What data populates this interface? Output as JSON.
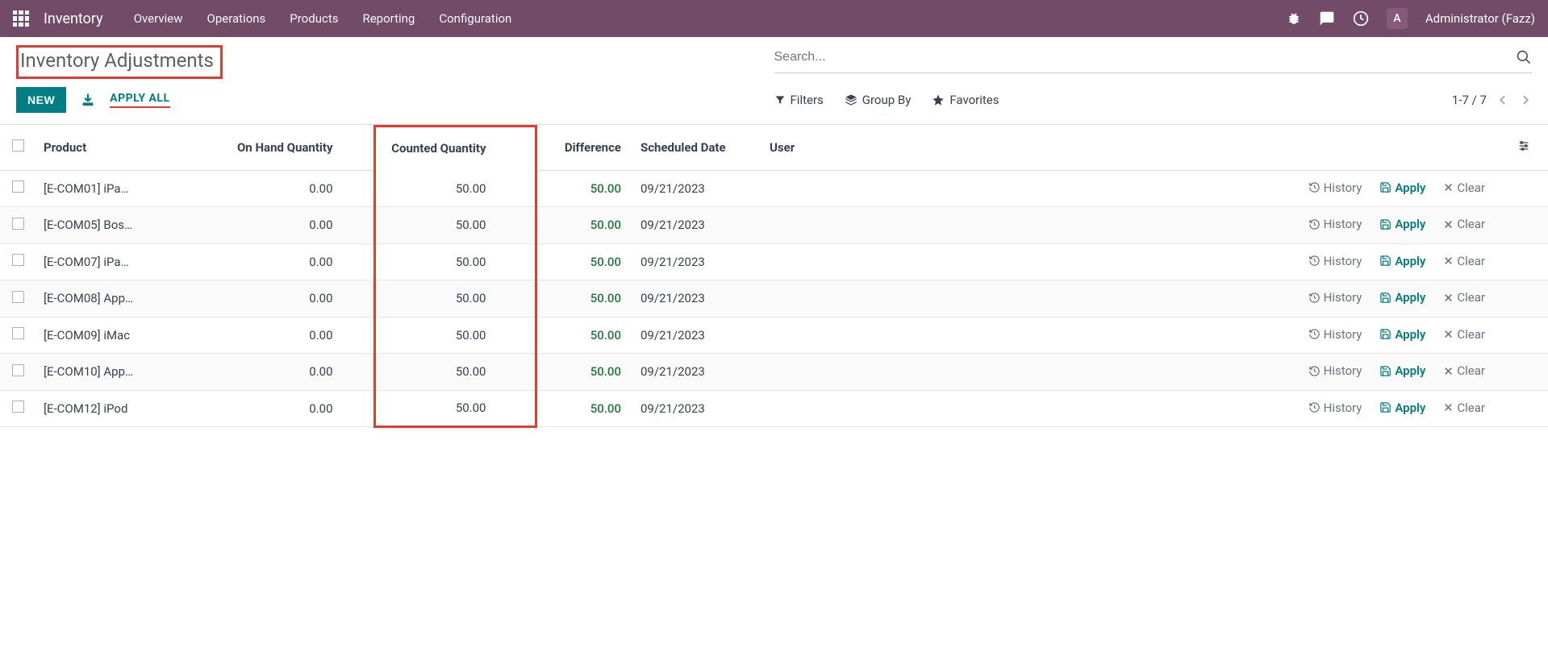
{
  "navbar": {
    "app_title": "Inventory",
    "links": [
      "Overview",
      "Operations",
      "Products",
      "Reporting",
      "Configuration"
    ],
    "avatar_letter": "A",
    "user_name": "Administrator (Fazz)"
  },
  "control_panel": {
    "breadcrumb": "Inventory Adjustments",
    "new_label": "NEW",
    "apply_all_label": "APPLY ALL",
    "search_placeholder": "Search...",
    "filters_label": "Filters",
    "groupby_label": "Group By",
    "favorites_label": "Favorites",
    "pager": "1-7 / 7"
  },
  "table": {
    "headers": {
      "product": "Product",
      "onhand": "On Hand Quantity",
      "counted": "Counted Quantity",
      "difference": "Difference",
      "scheduled": "Scheduled Date",
      "user": "User"
    },
    "action_labels": {
      "history": "History",
      "apply": "Apply",
      "clear": "Clear"
    },
    "rows": [
      {
        "product": "[E-COM01] iPa…",
        "onhand": "0.00",
        "counted": "50.00",
        "diff": "50.00",
        "date": "09/21/2023"
      },
      {
        "product": "[E-COM05] Bos…",
        "onhand": "0.00",
        "counted": "50.00",
        "diff": "50.00",
        "date": "09/21/2023"
      },
      {
        "product": "[E-COM07] iPa…",
        "onhand": "0.00",
        "counted": "50.00",
        "diff": "50.00",
        "date": "09/21/2023"
      },
      {
        "product": "[E-COM08] App…",
        "onhand": "0.00",
        "counted": "50.00",
        "diff": "50.00",
        "date": "09/21/2023"
      },
      {
        "product": "[E-COM09] iMac",
        "onhand": "0.00",
        "counted": "50.00",
        "diff": "50.00",
        "date": "09/21/2023"
      },
      {
        "product": "[E-COM10] App…",
        "onhand": "0.00",
        "counted": "50.00",
        "diff": "50.00",
        "date": "09/21/2023"
      },
      {
        "product": "[E-COM12] iPod",
        "onhand": "0.00",
        "counted": "50.00",
        "diff": "50.00",
        "date": "09/21/2023"
      }
    ]
  }
}
